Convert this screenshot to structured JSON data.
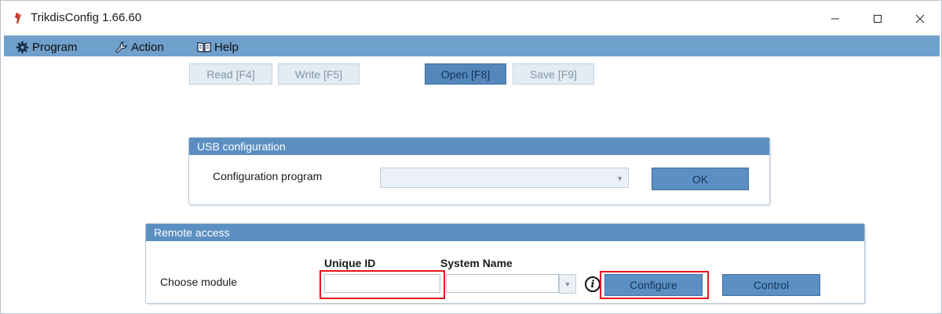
{
  "window": {
    "title": "TrikdisConfig 1.66.60"
  },
  "menu": {
    "program": "Program",
    "action": "Action",
    "help": "Help",
    "icons": [
      "gear-icon",
      "wrench-icon",
      "book-icon"
    ]
  },
  "toolbar": {
    "read": "Read [F4]",
    "write": "Write [F5]",
    "open": "Open [F8]",
    "save": "Save [F9]"
  },
  "usb": {
    "header": "USB configuration",
    "config_label": "Configuration program",
    "config_value": "",
    "ok": "OK"
  },
  "remote": {
    "header": "Remote access",
    "choose_label": "Choose module",
    "unique_id_header": "Unique ID",
    "system_name_header": "System Name",
    "unique_id_value": "",
    "system_name_value": "",
    "configure": "Configure",
    "control": "Control"
  },
  "colors": {
    "accent": "#5b8fc2",
    "menubar": "#6f9fcb",
    "highlight": "#e8141c"
  }
}
